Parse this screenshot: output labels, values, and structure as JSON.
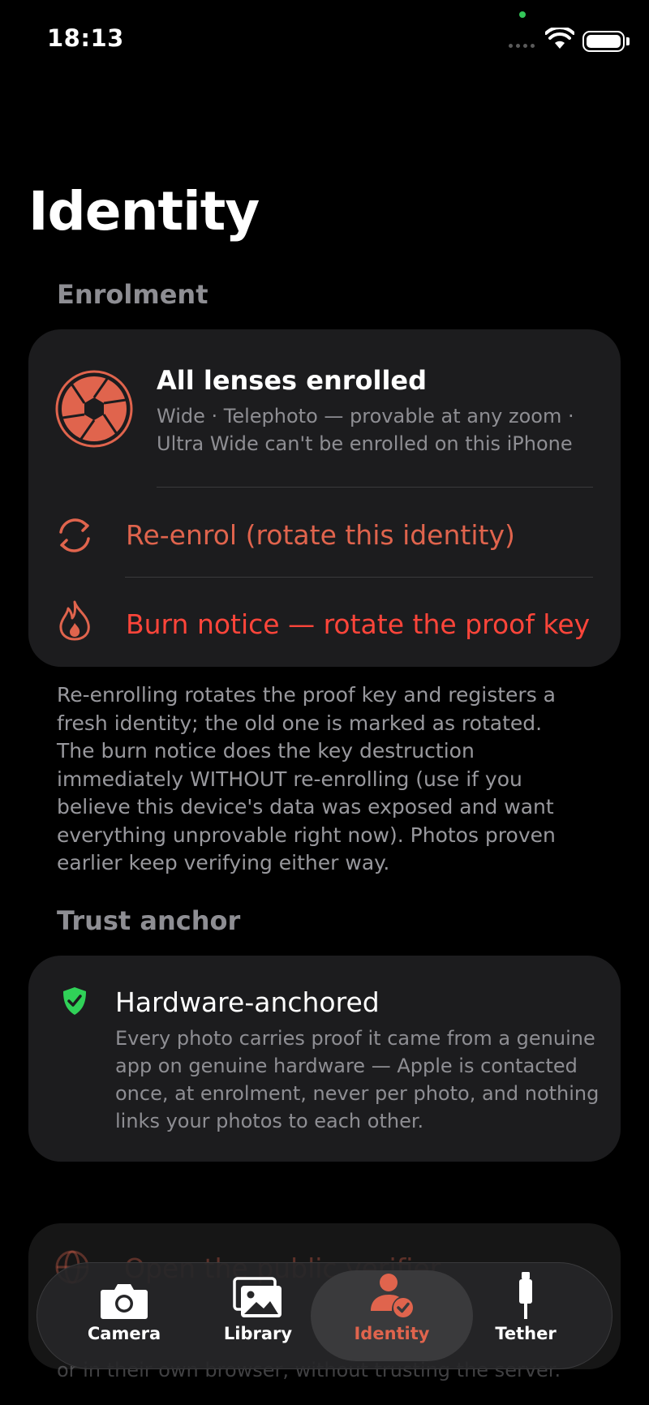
{
  "status_bar": {
    "time": "18:13"
  },
  "page": {
    "title": "Identity"
  },
  "enrolment": {
    "header": "Enrolment",
    "status_title": "All lenses enrolled",
    "status_sub_line1": "Wide · Telephoto — provable at any zoom ·",
    "status_sub_line2": "Ultra Wide can't be enrolled on this iPhone",
    "reenrol_label": "Re-enrol (rotate this identity)",
    "burn_label": "Burn notice — rotate the proof key",
    "footer_note": "Re-enrolling rotates the proof key and registers a fresh identity; the old one is marked as rotated. The burn notice does the key destruction immediately WITHOUT re-enrolling (use if you believe this device's data was exposed and want everything unprovable right now). Photos proven earlier keep verifying either way."
  },
  "trust_anchor": {
    "header": "Trust anchor",
    "title": "Hardware-anchored",
    "description": "Every photo carries proof it came from a genuine app on genuine hardware — Apple is contacted once, at enrolment, never per photo, and nothing links your photos to each other."
  },
  "partially_hidden": {
    "row_label": "Open the public verifier",
    "note": "or in their own browser, without trusting the server."
  },
  "tabbar": {
    "tabs": [
      {
        "label": "Camera",
        "icon": "camera-icon",
        "active": false
      },
      {
        "label": "Library",
        "icon": "photo-library-icon",
        "active": false
      },
      {
        "label": "Identity",
        "icon": "person-checkmark-icon",
        "active": true
      },
      {
        "label": "Tether",
        "icon": "cable-icon",
        "active": false
      }
    ]
  },
  "colors": {
    "accent": "#e0644d",
    "destructive": "#ff453a",
    "success": "#34c759",
    "card_bg": "#1c1c1e",
    "secondary_text": "#8e8e93"
  }
}
